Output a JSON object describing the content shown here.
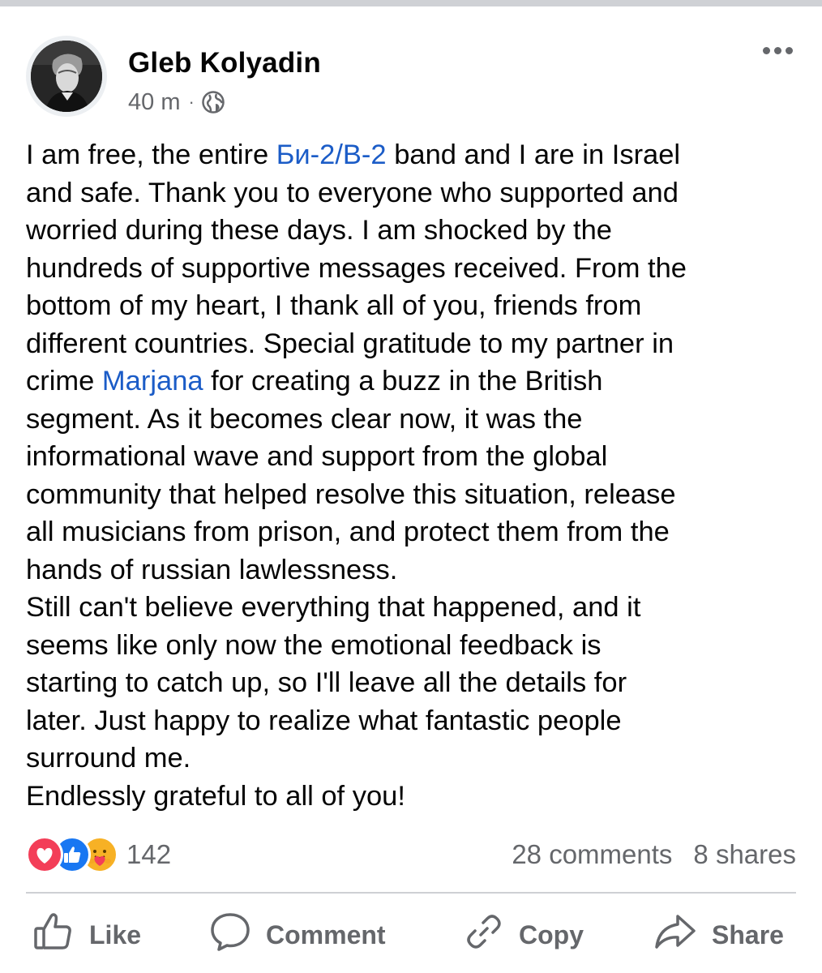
{
  "post": {
    "author": "Gleb Kolyadin",
    "time": "40 m",
    "separator": "·",
    "audience_icon": "globe-icon",
    "menu_icon": "more-horizontal-icon",
    "body_lines": [
      [
        {
          "text": "I am free, the entire "
        },
        {
          "text": "Би-2/B-2",
          "link": true
        },
        {
          "text": " band and I are in Israel"
        }
      ],
      [
        {
          "text": "and safe. Thank you to everyone who supported and"
        }
      ],
      [
        {
          "text": "worried during these days. I am shocked by the"
        }
      ],
      [
        {
          "text": "hundreds of supportive messages received. From the"
        }
      ],
      [
        {
          "text": "bottom of my heart, I thank all of you, friends from"
        }
      ],
      [
        {
          "text": "different countries. Special gratitude to my partner in"
        }
      ],
      [
        {
          "text": "crime "
        },
        {
          "text": "Marjana",
          "link": true
        },
        {
          "text": " for creating a buzz in the British"
        }
      ],
      [
        {
          "text": "segment. As it becomes clear now, it was the"
        }
      ],
      [
        {
          "text": "informational wave and support from the global"
        }
      ],
      [
        {
          "text": "community that helped resolve this situation, release"
        }
      ],
      [
        {
          "text": "all musicians from prison, and protect them from the"
        }
      ],
      [
        {
          "text": "hands of russian lawlessness."
        }
      ],
      [
        {
          "text": "Still can't believe everything that happened, and it"
        }
      ],
      [
        {
          "text": "seems like only now the emotional feedback is"
        }
      ],
      [
        {
          "text": "starting to catch up, so I'll leave all the details for"
        }
      ],
      [
        {
          "text": "later. Just happy to realize what fantastic people"
        }
      ],
      [
        {
          "text": "surround me."
        }
      ],
      [
        {
          "text": "Endlessly grateful to all of you!"
        }
      ]
    ],
    "link_color": "#1b5cc7"
  },
  "stats": {
    "reaction_icons": [
      "love-reaction-icon",
      "like-reaction-icon",
      "care-reaction-icon"
    ],
    "reaction_count": "142",
    "comments": "28 comments",
    "shares": "8 shares"
  },
  "actions": {
    "like": {
      "label": "Like",
      "icon": "thumbs-up-icon"
    },
    "comment": {
      "label": "Comment",
      "icon": "speech-bubble-icon"
    },
    "copy": {
      "label": "Copy",
      "icon": "link-icon"
    },
    "share": {
      "label": "Share",
      "icon": "share-arrow-icon"
    }
  },
  "colors": {
    "text": "#050505",
    "secondary": "#65676b",
    "love": "#f33e58",
    "like": "#1877f2",
    "care": "#f7b125"
  }
}
